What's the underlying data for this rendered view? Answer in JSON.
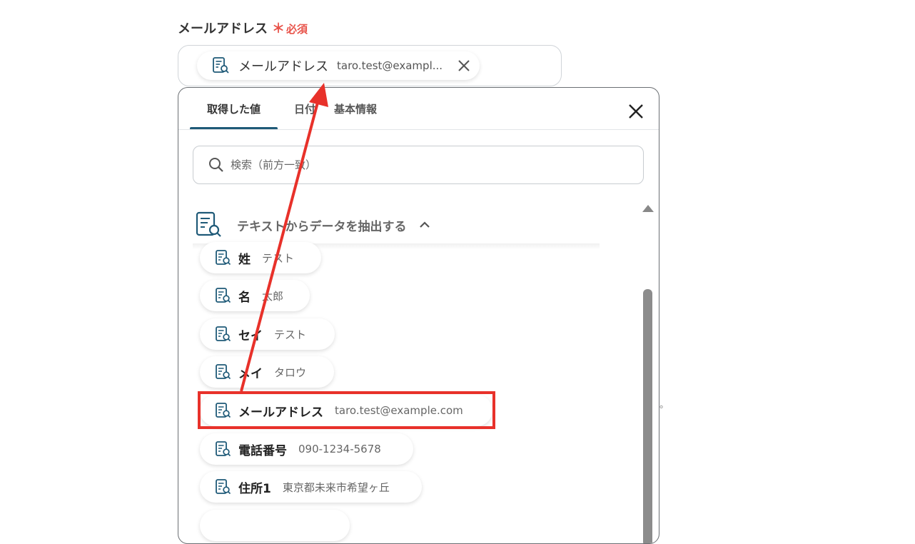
{
  "field": {
    "label": "メールアドレス",
    "required_mark": "＊",
    "required_text": "必須"
  },
  "selected_chip": {
    "label": "メールアドレス",
    "value": "taro.test@exampl..."
  },
  "tabs": [
    {
      "label": "取得した値",
      "active": true
    },
    {
      "label": "日付",
      "active": false
    },
    {
      "label": "基本情報",
      "active": false
    }
  ],
  "search": {
    "placeholder": "検索（前方一致）"
  },
  "section": {
    "title": "テキストからデータを抽出する"
  },
  "items": [
    {
      "label": "姓",
      "value": "テスト"
    },
    {
      "label": "名",
      "value": "太郎"
    },
    {
      "label": "セイ",
      "value": "テスト"
    },
    {
      "label": "メイ",
      "value": "タロウ"
    },
    {
      "label": "メールアドレス",
      "value": "taro.test@example.com"
    },
    {
      "label": "電話番号",
      "value": "090-1234-5678"
    },
    {
      "label": "住所1",
      "value": "東京都未来市希望ヶ丘"
    }
  ],
  "stray_text": "。",
  "colors": {
    "accent": "#1f5a78",
    "required": "#e8534a",
    "annotation_red": "#e8312a"
  }
}
